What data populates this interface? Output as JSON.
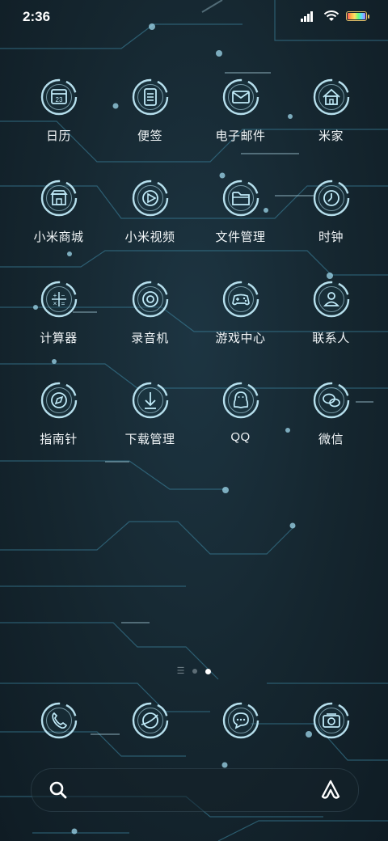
{
  "status_bar": {
    "time": "2:36",
    "signal_icon": "signal-bars-icon",
    "wifi_icon": "wifi-icon",
    "battery_icon": "battery-icon"
  },
  "home_apps": [
    {
      "label": "日历",
      "icon": "calendar-icon"
    },
    {
      "label": "便签",
      "icon": "notes-icon"
    },
    {
      "label": "电子邮件",
      "icon": "email-icon"
    },
    {
      "label": "米家",
      "icon": "home-icon"
    },
    {
      "label": "小米商城",
      "icon": "store-icon"
    },
    {
      "label": "小米视频",
      "icon": "video-play-icon"
    },
    {
      "label": "文件管理",
      "icon": "folder-icon"
    },
    {
      "label": "时钟",
      "icon": "clock-icon"
    },
    {
      "label": "计算器",
      "icon": "calculator-icon"
    },
    {
      "label": "录音机",
      "icon": "recorder-icon"
    },
    {
      "label": "游戏中心",
      "icon": "gamepad-icon"
    },
    {
      "label": "联系人",
      "icon": "contacts-icon"
    },
    {
      "label": "指南针",
      "icon": "compass-icon"
    },
    {
      "label": "下载管理",
      "icon": "download-icon"
    },
    {
      "label": "QQ",
      "icon": "qq-penguin-icon"
    },
    {
      "label": "微信",
      "icon": "wechat-icon"
    }
  ],
  "calendar_day": "23",
  "page_indicator": {
    "pages": 2,
    "active": 2
  },
  "dock_apps": [
    {
      "icon": "phone-icon"
    },
    {
      "icon": "browser-icon"
    },
    {
      "icon": "messages-icon"
    },
    {
      "icon": "camera-icon"
    }
  ],
  "search_bar": {
    "search_icon": "search-icon",
    "assistant_icon": "assistant-icon"
  },
  "colors": {
    "glow": "#bfe9f7",
    "circuit": "#4fa0bd",
    "background": "#15262f"
  }
}
